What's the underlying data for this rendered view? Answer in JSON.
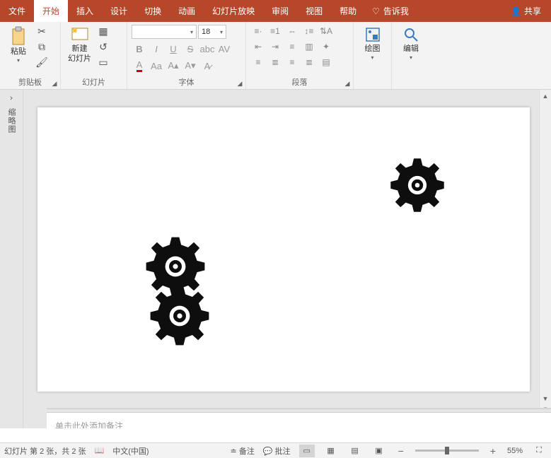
{
  "tabs": {
    "file": "文件",
    "home": "开始",
    "insert": "插入",
    "design": "设计",
    "transitions": "切换",
    "animations": "动画",
    "slideshow": "幻灯片放映",
    "review": "审阅",
    "view": "视图",
    "help": "帮助",
    "tellme": "告诉我",
    "share": "共享"
  },
  "ribbon": {
    "clipboard": {
      "paste": "粘贴",
      "label": "剪贴板"
    },
    "slides": {
      "new": "新建",
      "new2": "幻灯片",
      "label": "幻灯片"
    },
    "font": {
      "label": "字体",
      "name": "",
      "size": "18"
    },
    "paragraph": {
      "label": "段落"
    },
    "drawing": {
      "btn": "绘图",
      "label": ""
    },
    "editing": {
      "btn": "编辑",
      "label": ""
    }
  },
  "notes": {
    "placeholder": "单击此处添加备注"
  },
  "status": {
    "slide": "幻灯片 第 2 张，共 2 张",
    "lang": "中文(中国)",
    "notes": "备注",
    "comments": "批注",
    "zoom": "55%"
  },
  "thumb": {
    "label": "缩略图"
  }
}
